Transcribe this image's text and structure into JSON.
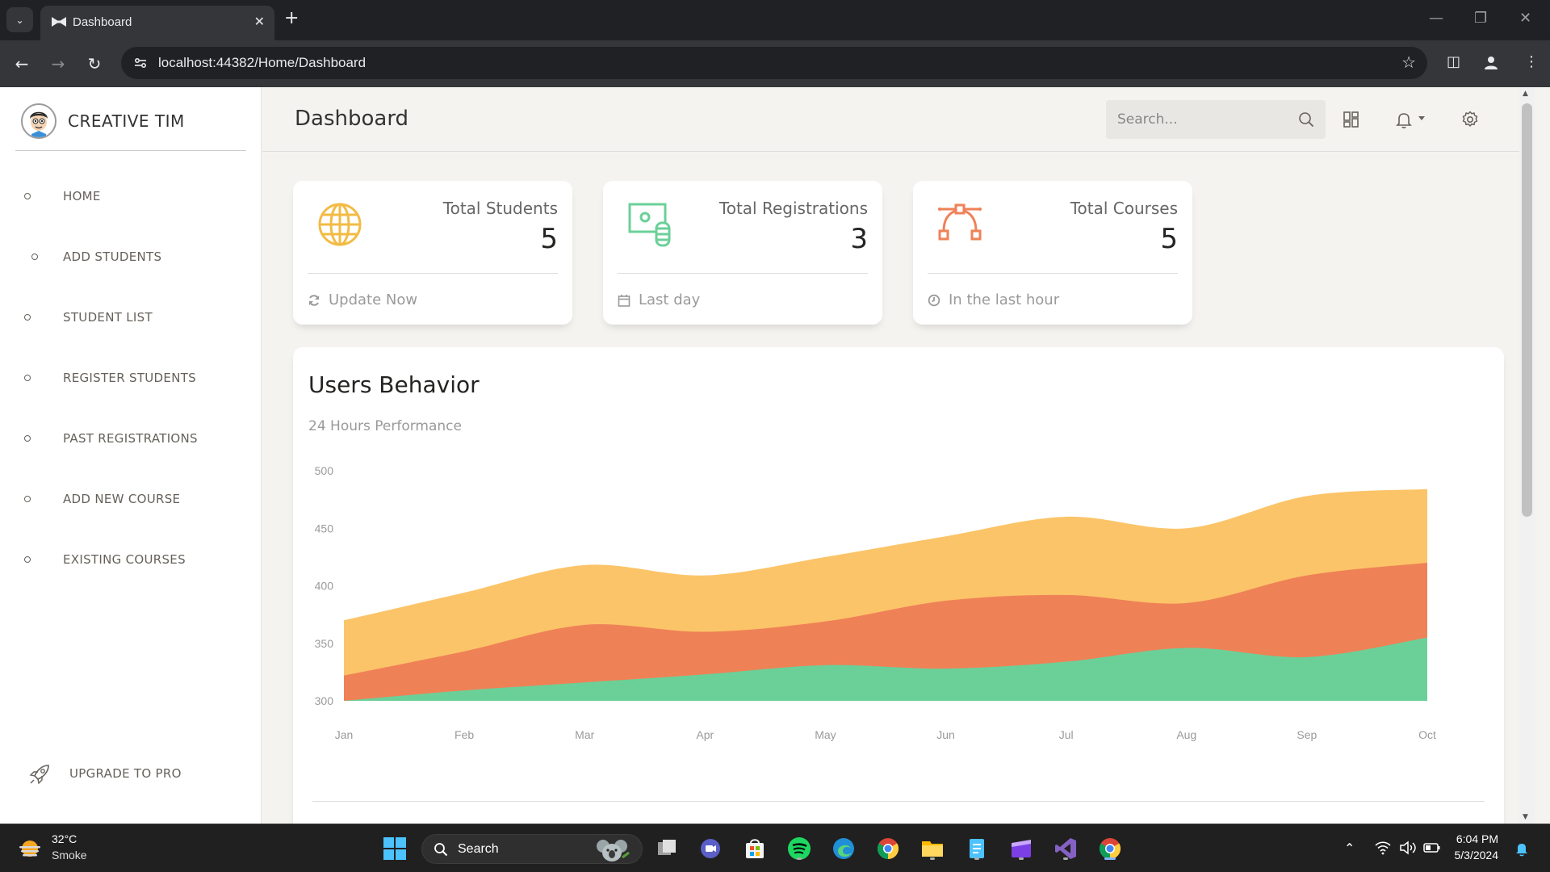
{
  "browser": {
    "tab_title": "Dashboard",
    "url": "localhost:44382/Home/Dashboard",
    "icons": [
      "tab-list-icon",
      "new-tab-icon",
      "back-icon",
      "forward-icon",
      "reload-icon",
      "site-info-icon",
      "star-icon",
      "sidebar-icon",
      "profile-icon",
      "menu-icon"
    ]
  },
  "sidebar": {
    "brand": "CREATIVE TIM",
    "items": [
      {
        "label": "HOME"
      },
      {
        "label": "ADD STUDENTS"
      },
      {
        "label": "STUDENT LIST"
      },
      {
        "label": "REGISTER STUDENTS"
      },
      {
        "label": "PAST REGISTRATIONS"
      },
      {
        "label": "ADD NEW COURSE"
      },
      {
        "label": "EXISTING COURSES"
      }
    ],
    "upgrade_label": "UPGRADE TO PRO"
  },
  "header": {
    "title": "Dashboard",
    "search_placeholder": "Search..."
  },
  "stats": [
    {
      "label": "Total Students",
      "value": "5",
      "footer": "Update Now",
      "icon": "globe-icon",
      "color": "#f3bb45"
    },
    {
      "label": "Total Registrations",
      "value": "3",
      "footer": "Last day",
      "icon": "money-coins-icon",
      "color": "#6bd098"
    },
    {
      "label": "Total Courses",
      "value": "5",
      "footer": "In the last hour",
      "icon": "vector-icon",
      "color": "#ef8157"
    }
  ],
  "chart": {
    "title": "Users Behavior",
    "subtitle": "24 Hours Performance"
  },
  "chart_data": {
    "type": "area",
    "categories": [
      "Jan",
      "Feb",
      "Mar",
      "Apr",
      "May",
      "Jun",
      "Jul",
      "Aug",
      "Sep",
      "Oct"
    ],
    "ylim": [
      300,
      500
    ],
    "yticks": [
      300,
      350,
      400,
      450,
      500
    ],
    "grid": false,
    "series": [
      {
        "values": [
          370,
          394,
          418,
          409,
          425,
          443,
          460,
          450,
          478,
          484
        ],
        "color": "#fcc468"
      },
      {
        "values": [
          322,
          343,
          366,
          360,
          369,
          387,
          392,
          385,
          409,
          420
        ],
        "color": "#ef8157"
      },
      {
        "values": [
          300,
          309,
          316,
          323,
          331,
          328,
          334,
          346,
          338,
          355
        ],
        "color": "#6bd098"
      }
    ]
  },
  "taskbar": {
    "weather_temp": "32°C",
    "weather_desc": "Smoke",
    "search_label": "Search",
    "time": "6:04 PM",
    "date": "5/3/2024"
  }
}
